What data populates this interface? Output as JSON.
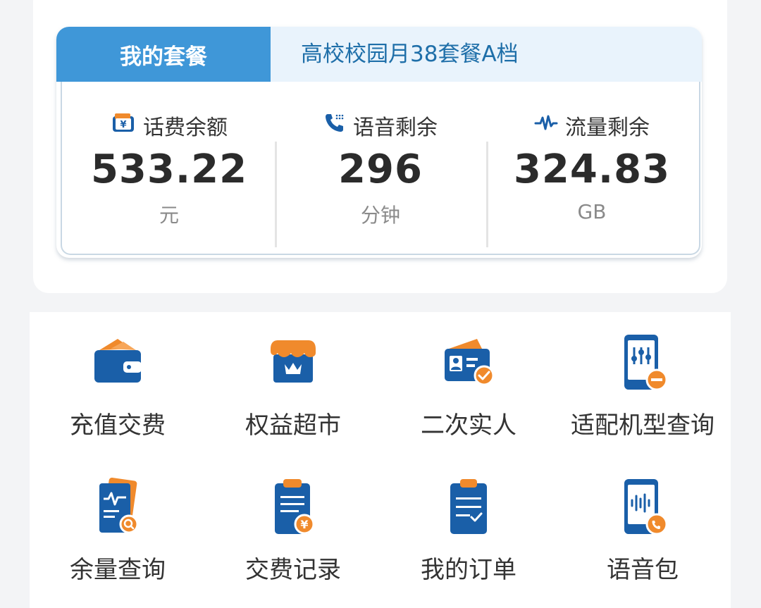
{
  "plan": {
    "tab_label": "我的套餐",
    "plan_name": "高校校园月38套餐A档"
  },
  "stats": [
    {
      "label": "话费余额",
      "value": "533.22",
      "unit": "元",
      "icon": "wallet-yuan-icon"
    },
    {
      "label": "语音剩余",
      "value": "296",
      "unit": "分钟",
      "icon": "phone-icon"
    },
    {
      "label": "流量剩余",
      "value": "324.83",
      "unit": "GB",
      "icon": "pulse-icon"
    }
  ],
  "services": [
    {
      "label": "充值交费",
      "icon": "wallet-icon"
    },
    {
      "label": "权益超市",
      "icon": "store-crown-icon"
    },
    {
      "label": "二次实人",
      "icon": "id-card-check-icon"
    },
    {
      "label": "适配机型查询",
      "icon": "phone-settings-icon"
    },
    {
      "label": "余量查询",
      "icon": "document-search-icon"
    },
    {
      "label": "交费记录",
      "icon": "clipboard-yuan-icon"
    },
    {
      "label": "我的订单",
      "icon": "clipboard-check-icon"
    },
    {
      "label": "语音包",
      "icon": "phone-voice-icon"
    }
  ],
  "colors": {
    "primary_blue": "#1a5fa8",
    "tab_blue": "#3f97d8",
    "accent_orange": "#f08a2c",
    "plan_name_blue": "#1f6fa9"
  }
}
